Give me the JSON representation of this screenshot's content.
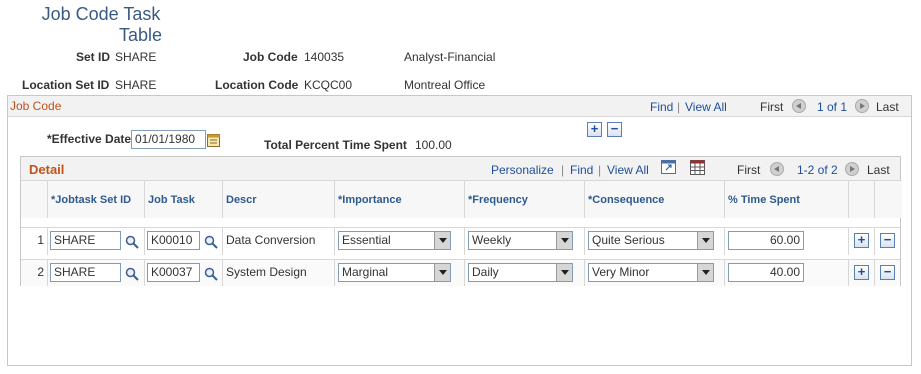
{
  "page": {
    "title_line1": "Job Code Task",
    "title_line2": "Table"
  },
  "header": {
    "set_id_label": "Set ID",
    "set_id_value": "SHARE",
    "job_code_label": "Job Code",
    "job_code_value": "140035",
    "job_code_descr": "Analyst-Financial",
    "location_set_id_label": "Location Set ID",
    "location_set_id_value": "SHARE",
    "location_code_label": "Location Code",
    "location_code_value": "KCQC00",
    "location_descr": "Montreal Office"
  },
  "job_code_section": {
    "title": "Job Code",
    "find": "Find",
    "sep": "|",
    "view_all": "View All",
    "first": "First",
    "range": "1 of 1",
    "last": "Last",
    "effective_date_label": "*Effective Date",
    "effective_date_value": "01/01/1980",
    "total_percent_label": "Total Percent Time Spent",
    "total_percent_value": "100.00",
    "add_symbol": "+",
    "remove_symbol": "−"
  },
  "detail": {
    "title": "Detail",
    "personalize": "Personalize",
    "find": "Find",
    "view_all": "View All",
    "first": "First",
    "range": "1-2 of 2",
    "last": "Last",
    "sep": "|",
    "columns": {
      "jobtask_set_id": "*Jobtask Set ID",
      "job_task": "Job Task",
      "descr": "Descr",
      "importance": "*Importance",
      "frequency": "*Frequency",
      "consequence": "*Consequence",
      "time_spent": "% Time Spent"
    },
    "rows": [
      {
        "num": "1",
        "set_id": "SHARE",
        "job_task": "K00010",
        "descr": "Data Conversion",
        "importance": "Essential",
        "frequency": "Weekly",
        "consequence": "Quite Serious",
        "time_spent": "60.00"
      },
      {
        "num": "2",
        "set_id": "SHARE",
        "job_task": "K00037",
        "descr": "System Design",
        "importance": "Marginal",
        "frequency": "Daily",
        "consequence": "Very Minor",
        "time_spent": "40.00"
      }
    ],
    "add_symbol": "+",
    "remove_symbol": "−"
  },
  "icons": {
    "lookup": "magnifier-icon",
    "calendar": "calendar-icon",
    "zoom": "zoom-icon",
    "download": "download-grid-icon",
    "prev": "previous-arrow-icon",
    "next": "next-arrow-icon"
  }
}
